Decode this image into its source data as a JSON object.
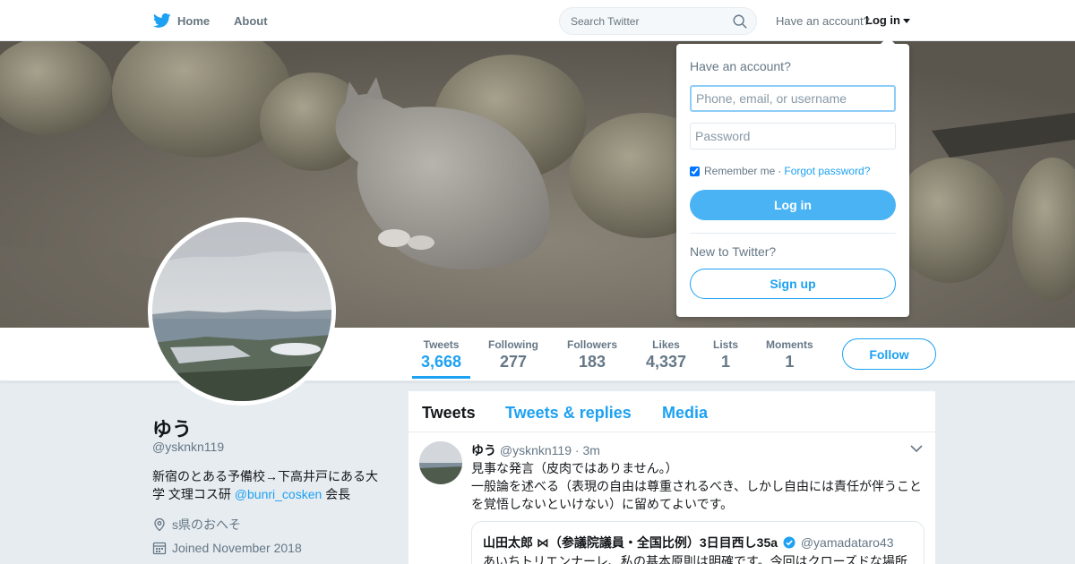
{
  "nav": {
    "home_label": "Home",
    "about_label": "About",
    "search_placeholder": "Search Twitter",
    "have_account": "Have an account?",
    "login_label": "Log in"
  },
  "profile": {
    "name": "ゆう",
    "handle": "@ysknkn119",
    "bio_text": "新宿のとある予備校→下高井戸にある大学 文理コス研 ",
    "bio_link": "@bunri_cosken",
    "bio_suffix": " 会長",
    "location": "s県のおへそ",
    "joined": "Joined November 2018"
  },
  "stats": [
    {
      "label": "Tweets",
      "value": "3,668"
    },
    {
      "label": "Following",
      "value": "277"
    },
    {
      "label": "Followers",
      "value": "183"
    },
    {
      "label": "Likes",
      "value": "4,337"
    },
    {
      "label": "Lists",
      "value": "1"
    },
    {
      "label": "Moments",
      "value": "1"
    }
  ],
  "follow_label": "Follow",
  "tabs": [
    "Tweets",
    "Tweets & replies",
    "Media"
  ],
  "tweet": {
    "name": "ゆう",
    "handle": "@ysknkn119",
    "time": "· 3m",
    "text": "見事な発言（皮肉ではありません。）\n一般論を述べる（表現の自由は尊重されるべき、しかし自由には責任が伴うことを覚悟しないといけない）に留めてよいです。",
    "quote": {
      "name": "山田太郎 ⋈（参議院議員・全国比例）3日目西し35a",
      "handle": "@yamadataro43",
      "text": "あいちトリエンナーレ、私の基本原則は明確です。今回はクローズドな場所"
    }
  },
  "login_dropdown": {
    "title": "Have an account?",
    "username_placeholder": "Phone, email, or username",
    "password_placeholder": "Password",
    "remember_label": "Remember me",
    "separator": "·",
    "forgot_label": "Forgot password?",
    "login_button": "Log in",
    "new_label": "New to Twitter?",
    "signup_button": "Sign up"
  },
  "colors": {
    "brand": "#1da1f2",
    "background": "#e6ecf0",
    "login_button": "#4ab3f4"
  },
  "icons": {
    "logo": "twitter-bird-icon",
    "search": "search-icon",
    "location": "location-pin-icon",
    "calendar": "calendar-icon",
    "verified": "verified-badge-icon",
    "caret": "chevron-down-icon"
  }
}
